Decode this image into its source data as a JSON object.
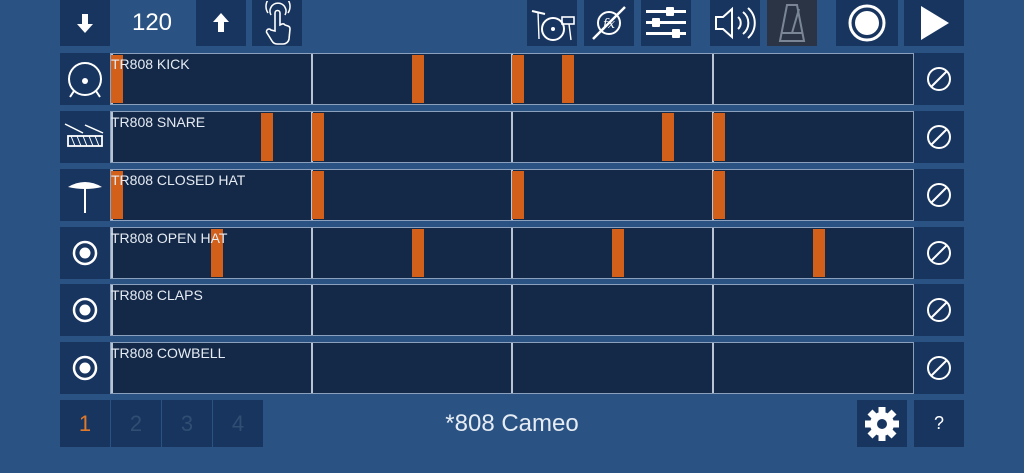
{
  "transport": {
    "tempo": "120",
    "tempo_down_icon": "arrow-down-icon",
    "tempo_up_icon": "arrow-up-icon",
    "tap_icon": "tap-hand-icon",
    "drumkit_icon": "drumkit-icon",
    "fx_icon": "fx-icon",
    "mixer_icon": "mixer-sliders-icon",
    "volume_icon": "speaker-icon",
    "metronome_icon": "metronome-icon",
    "record_icon": "record-icon",
    "play_icon": "play-icon"
  },
  "tracks": [
    {
      "name": "TR808 KICK",
      "icon": "kick-drum-icon",
      "steps": [
        0,
        6,
        8,
        9
      ]
    },
    {
      "name": "TR808 SNARE",
      "icon": "snare-drum-icon",
      "steps": [
        3,
        4,
        11,
        12
      ]
    },
    {
      "name": "TR808 CLOSED HAT",
      "icon": "hihat-icon",
      "steps": [
        0,
        4,
        8,
        12
      ]
    },
    {
      "name": "TR808 OPEN HAT",
      "icon": "radio-icon",
      "steps": [
        2,
        6,
        10,
        14
      ]
    },
    {
      "name": "TR808 CLAPS",
      "icon": "radio-icon",
      "steps": []
    },
    {
      "name": "TR808 COWBELL",
      "icon": "radio-icon",
      "steps": []
    }
  ],
  "steps_per_bar": 16,
  "mute_icon": "mute-icon",
  "patterns": [
    {
      "label": "1",
      "active": true
    },
    {
      "label": "2",
      "active": false
    },
    {
      "label": "3",
      "active": false
    },
    {
      "label": "4",
      "active": false
    }
  ],
  "preset_name": "*808 Cameo",
  "settings_icon": "gear-icon",
  "help_label": "?",
  "colors": {
    "background": "#2a5283",
    "button": "#183560",
    "grid": "#142848",
    "note": "#d2601a",
    "active_pattern": "#e07a2a",
    "inactive_pattern": "#2f4e72"
  }
}
